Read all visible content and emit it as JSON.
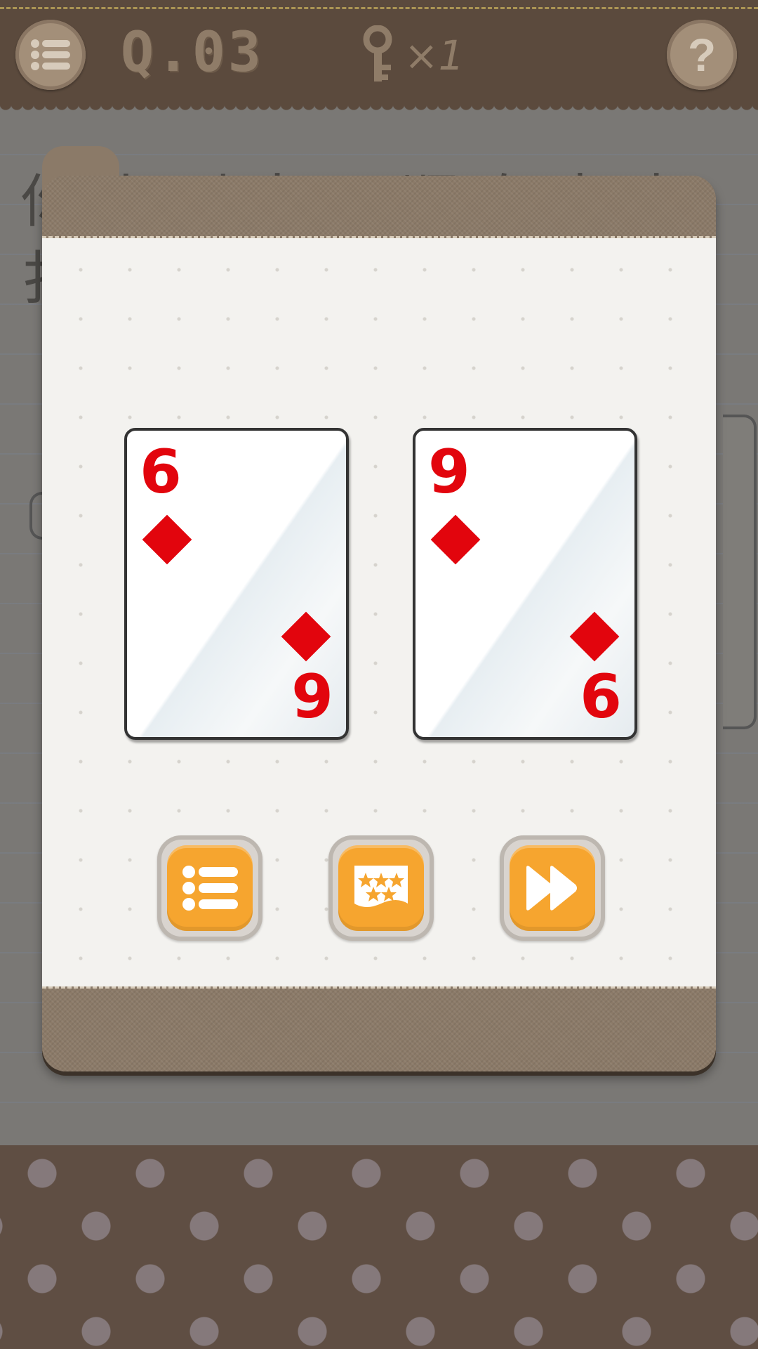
{
  "header": {
    "level_label": "Q.03",
    "key_count": "×1",
    "help_label": "?"
  },
  "background": {
    "line1": "你小到大，顺次点击",
    "line2": "扌"
  },
  "cards": [
    {
      "top_rank": "6",
      "bottom_rank": "9",
      "suit": "diamond"
    },
    {
      "top_rank": "9",
      "bottom_rank": "6",
      "suit": "diamond"
    }
  ],
  "buttons": {
    "level_list": "list-icon",
    "level_select": "stars-grid-icon",
    "next": "fast-forward-icon"
  },
  "colors": {
    "accent_orange": "#f6a52f",
    "card_red": "#e2050d",
    "header_brown": "#5b4a3d"
  }
}
